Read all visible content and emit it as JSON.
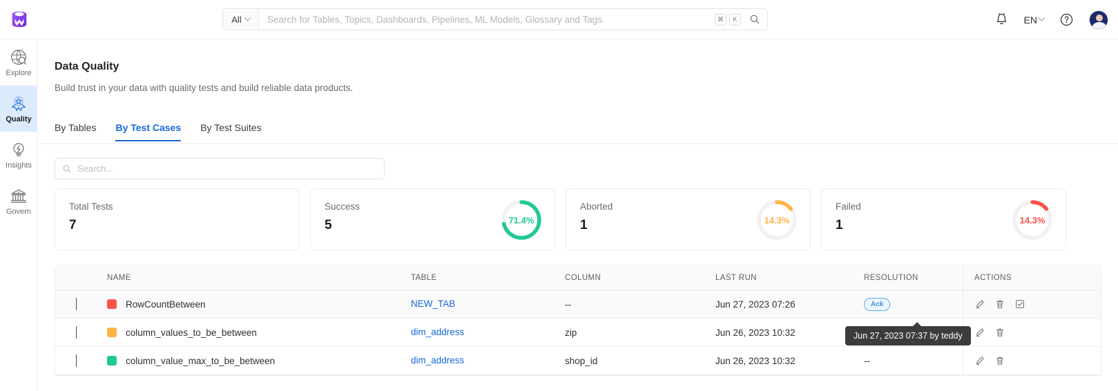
{
  "topbar": {
    "logo_icon": "openmetadata-logo",
    "search_scope": "All",
    "scope_chevron_icon": "chevron-down-icon",
    "search_placeholder": "Search for Tables, Topics, Dashboards, Pipelines, ML Models, Glossary and Tags.",
    "search_value": "",
    "kbd_cmd": "⌘",
    "kbd_key": "K",
    "search_icon": "search-icon",
    "bell_icon": "notification-bell-icon",
    "language": "EN",
    "language_chevron_icon": "chevron-down-icon",
    "help_icon": "help-circle-icon",
    "avatar_icon": "user-avatar"
  },
  "sidebar": {
    "items": [
      {
        "label": "Explore",
        "icon": "globe-search-icon",
        "active": false
      },
      {
        "label": "Quality",
        "icon": "quality-ribbon-icon",
        "active": true
      },
      {
        "label": "Insights",
        "icon": "lightbulb-icon",
        "active": false
      },
      {
        "label": "Govern",
        "icon": "bank-icon",
        "active": false
      }
    ]
  },
  "page": {
    "title": "Data Quality",
    "subtitle": "Build trust in your data with quality tests and build reliable data products."
  },
  "tabs": [
    {
      "label": "By Tables",
      "active": false
    },
    {
      "label": "By Test Cases",
      "active": true
    },
    {
      "label": "By Test Suites",
      "active": false
    }
  ],
  "table_search": {
    "placeholder": "Search...",
    "value": "",
    "icon": "search-icon"
  },
  "cards": [
    {
      "label": "Total Tests",
      "value": "7",
      "percent": null,
      "percent_label": "",
      "color": "#000000",
      "has_donut": false
    },
    {
      "label": "Success",
      "value": "5",
      "percent": 71.4,
      "percent_label": "71.4%",
      "color": "#21c997",
      "has_donut": true
    },
    {
      "label": "Aborted",
      "value": "1",
      "percent": 14.3,
      "percent_label": "14.3%",
      "color": "#fdb447",
      "has_donut": true
    },
    {
      "label": "Failed",
      "value": "1",
      "percent": 14.3,
      "percent_label": "14.3%",
      "color": "#f9524a",
      "has_donut": true
    }
  ],
  "table": {
    "columns": [
      "NAME",
      "TABLE",
      "COLUMN",
      "LAST RUN",
      "RESOLUTION",
      "ACTIONS"
    ],
    "rows": [
      {
        "expand_icon": "chevron-right-icon",
        "status_color": "#f9524a",
        "name": "RowCountBetween",
        "table": "NEW_TAB",
        "column": "--",
        "last_run": "Jun 27, 2023 07:26",
        "resolution": "Ack",
        "resolution_is_badge": true,
        "actions": [
          "edit-icon",
          "delete-icon",
          "resolve-check-icon"
        ]
      },
      {
        "expand_icon": "chevron-right-icon",
        "status_color": "#fdb447",
        "name": "column_values_to_be_between",
        "table": "dim_address",
        "column": "zip",
        "last_run": "Jun 26, 2023 10:32",
        "resolution": "",
        "resolution_is_badge": false,
        "actions": [
          "edit-icon",
          "delete-icon"
        ]
      },
      {
        "expand_icon": "chevron-right-icon",
        "status_color": "#21c997",
        "name": "column_value_max_to_be_between",
        "table": "dim_address",
        "column": "shop_id",
        "last_run": "Jun 26, 2023 10:32",
        "resolution": "--",
        "resolution_is_badge": false,
        "actions": [
          "edit-icon",
          "delete-icon"
        ]
      }
    ]
  },
  "tooltip": {
    "text": "Jun 27, 2023 07:37 by teddy"
  },
  "colors": {
    "accent": "#1668d9",
    "success": "#21c997",
    "warning": "#fdb447",
    "danger": "#f9524a",
    "brand": "#7b3fe4"
  }
}
